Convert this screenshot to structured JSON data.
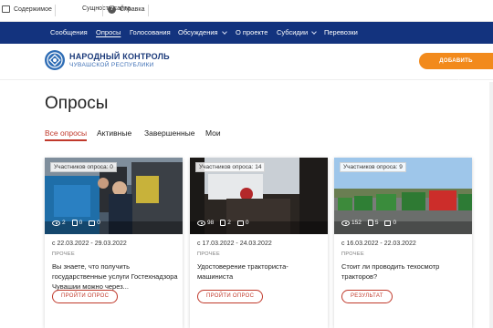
{
  "utility_bar": {
    "items": [
      {
        "label": "Содержимое",
        "icon": "grid-icon"
      },
      {
        "label": "Сущности сайта",
        "icon": "blank"
      },
      {
        "label": "Справка",
        "icon": "help-icon"
      }
    ]
  },
  "nav": {
    "items": [
      {
        "label": "Сообщения",
        "dropdown": false,
        "active": false
      },
      {
        "label": "Опросы",
        "dropdown": false,
        "active": true
      },
      {
        "label": "Голосования",
        "dropdown": false,
        "active": false
      },
      {
        "label": "Обсуждения",
        "dropdown": true,
        "active": false
      },
      {
        "label": "О проекте",
        "dropdown": false,
        "active": false
      },
      {
        "label": "Субсидии",
        "dropdown": true,
        "active": false
      },
      {
        "label": "Перевозки",
        "dropdown": false,
        "active": false
      }
    ]
  },
  "brand": {
    "title": "НАРОДНЫЙ КОНТРОЛЬ",
    "subtitle": "ЧУВАШСКОЙ РЕСПУБЛИКИ"
  },
  "header": {
    "add_button_label": "ДОБАВИТЬ СООБЩЕНИЕ"
  },
  "page": {
    "title": "Опросы",
    "tabs": [
      {
        "label": "Все опросы",
        "active": true
      },
      {
        "label": "Активные",
        "active": false
      },
      {
        "label": "Завершенные",
        "active": false
      },
      {
        "label": "Мои",
        "active": false
      }
    ]
  },
  "cards": [
    {
      "badge": "Участников опроса: 0",
      "views": "2",
      "likes": "0",
      "comments": "0",
      "date": "с 22.03.2022 - 29.03.2022",
      "category": "ПРОЧЕЕ",
      "text": "Вы знаете, что получить государственные услуги Гостехнадзора Чувашии можно через...",
      "button": "ПРОЙТИ ОПРОС"
    },
    {
      "badge": "Участников опроса: 14",
      "views": "98",
      "likes": "2",
      "comments": "0",
      "date": "с 17.03.2022 - 24.03.2022",
      "category": "ПРОЧЕЕ",
      "text": "Удостоверение тракториста-машиниста",
      "button": "ПРОЙТИ ОПРОС"
    },
    {
      "badge": "Участников опроса: 9",
      "views": "152",
      "likes": "5",
      "comments": "0",
      "date": "с 16.03.2022 - 22.03.2022",
      "category": "ПРОЧЕЕ",
      "text": "Стоит ли проводить техосмотр тракторов?",
      "button": "РЕЗУЛЬТАТ"
    }
  ],
  "colors": {
    "nav_bg": "#13337e",
    "accent_orange": "#f28a1c",
    "accent_red": "#c0392b",
    "brand_blue": "#1b3a7a"
  }
}
